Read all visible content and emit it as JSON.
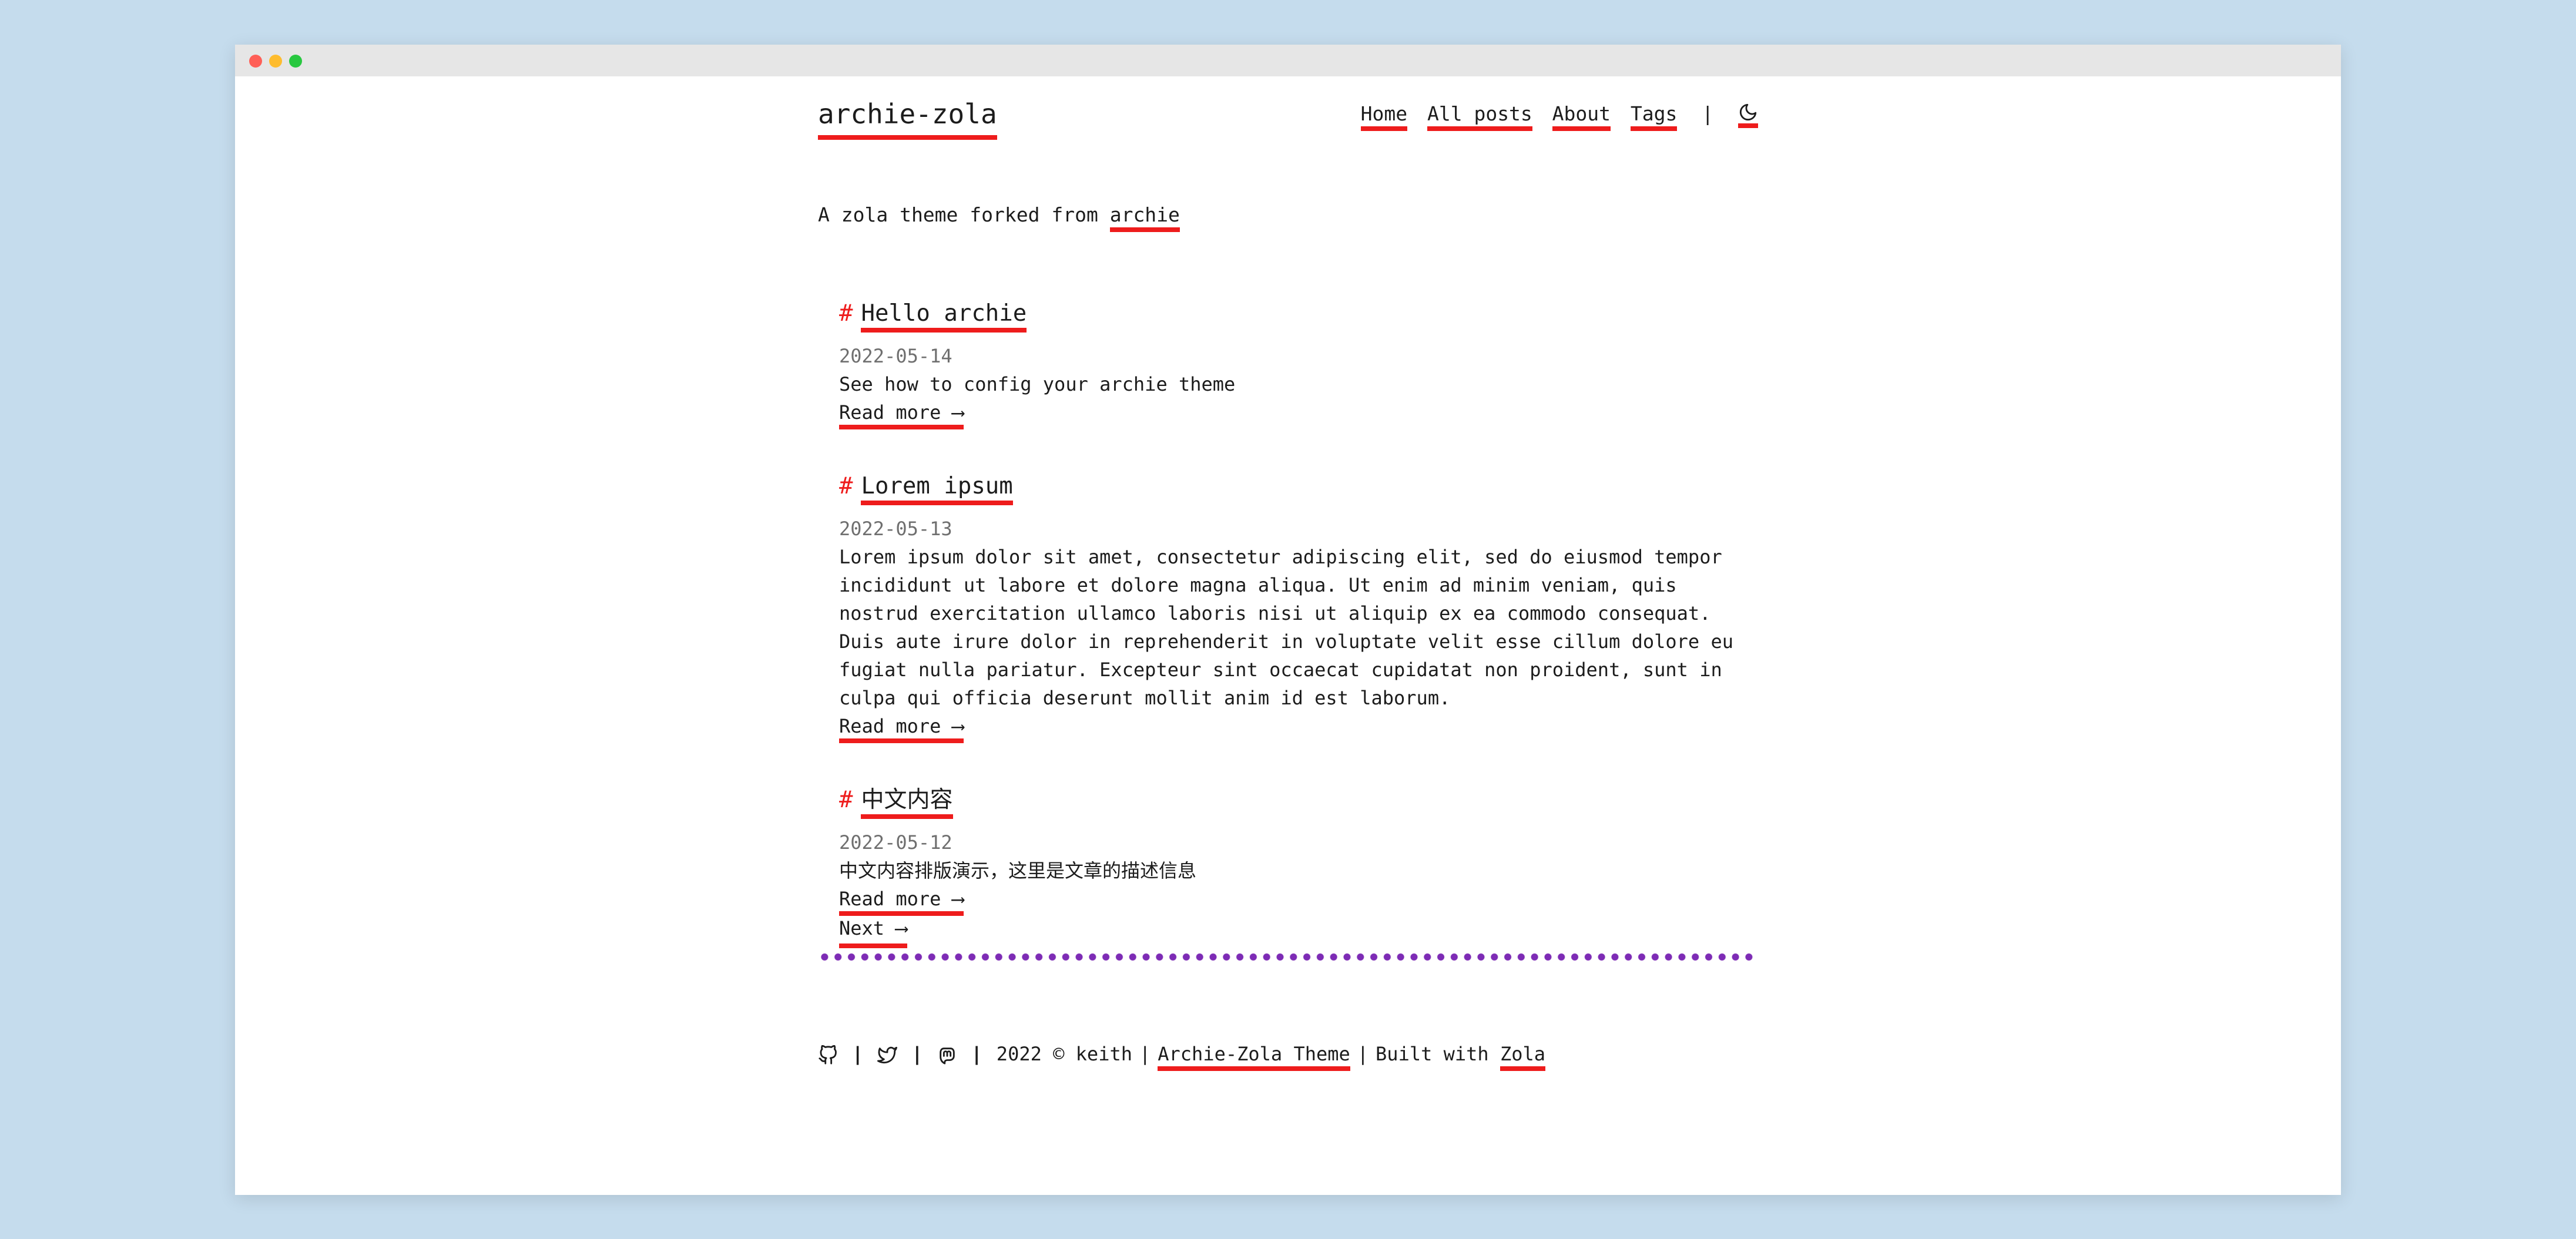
{
  "colors": {
    "page_background": "#c5dced",
    "titlebar": "#e6e6e6",
    "accent": "#ee1c1c",
    "divider": "#7d2bb5",
    "date": "#6f6f6f",
    "traffic_lights": [
      "#ff5f57",
      "#febc2e",
      "#28c840"
    ]
  },
  "site": {
    "title": "archie-zola"
  },
  "nav": {
    "items": [
      "Home",
      "All posts",
      "About",
      "Tags"
    ],
    "separator": "|",
    "theme_toggle_icon": "moon-icon"
  },
  "tagline": {
    "text": "A zola theme forked from ",
    "link": "archie"
  },
  "posts": [
    {
      "hash": "#",
      "title": "Hello archie",
      "date": "2022-05-14",
      "summary": "See how to config your archie theme",
      "read_more": "Read more ⟶"
    },
    {
      "hash": "#",
      "title": "Lorem ipsum",
      "date": "2022-05-13",
      "summary": "Lorem ipsum dolor sit amet, consectetur adipiscing elit, sed do eiusmod tempor incididunt ut labore et dolore magna aliqua. Ut enim ad minim veniam, quis nostrud exercitation ullamco laboris nisi ut aliquip ex ea commodo consequat. Duis aute irure dolor in reprehenderit in voluptate velit esse cillum dolore eu fugiat nulla pariatur. Excepteur sint occaecat cupidatat non proident, sunt in culpa qui officia deserunt mollit anim id est laborum.",
      "read_more": "Read more ⟶"
    },
    {
      "hash": "#",
      "title": "中文内容",
      "date": "2022-05-12",
      "summary": "中文内容排版演示，这里是文章的描述信息",
      "read_more": "Read more ⟶"
    }
  ],
  "pagination": {
    "next": "Next ⟶"
  },
  "footer": {
    "icons": [
      "github-icon",
      "twitter-icon",
      "mastodon-icon"
    ],
    "icon_separator": "|",
    "copyright": "2022 © keith",
    "pipe": "|",
    "theme_link": "Archie-Zola Theme",
    "built_with": "Built with",
    "zola_link": "Zola"
  }
}
